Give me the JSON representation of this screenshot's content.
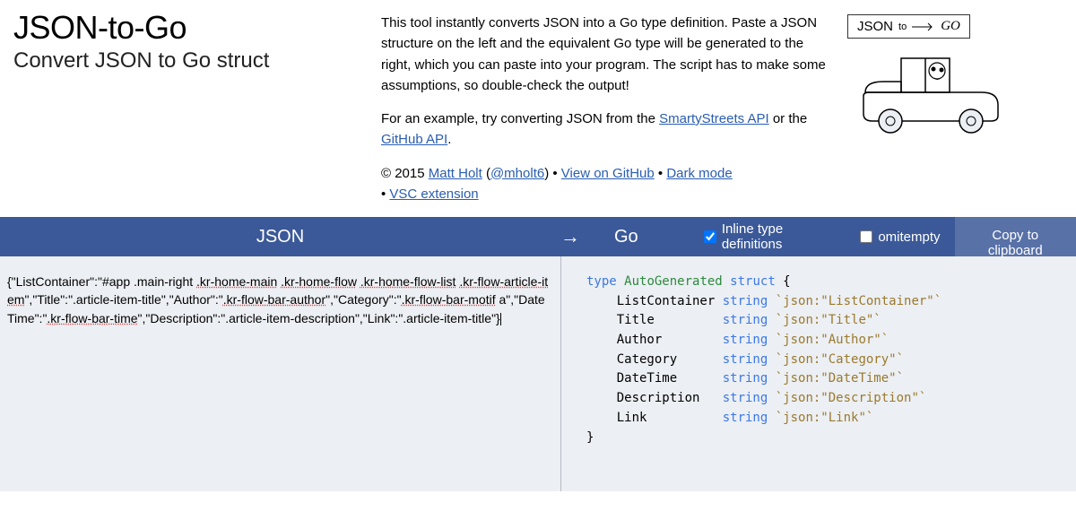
{
  "header": {
    "title": "JSON-to-Go",
    "subtitle": "Convert JSON to Go struct",
    "intro": "This tool instantly converts JSON into a Go type definition. Paste a JSON structure on the left and the equivalent Go type will be generated to the right, which you can paste into your program. The script has to make some assumptions, so double-check the output!",
    "example_prefix": "For an example, try converting JSON from the ",
    "link_smarty": "SmartyStreets API",
    "example_mid": " or the ",
    "link_github": "GitHub API",
    "example_suffix": ".",
    "copyright_prefix": "© 2015 ",
    "link_matt": "Matt Holt",
    "paren_open": " (",
    "link_mholt6": "@mholt6",
    "paren_close": ") • ",
    "link_viewgh": "View on GitHub",
    "sep": " • ",
    "link_dark": "Dark mode",
    "bullet": "• ",
    "link_vsc": "VSC extension",
    "logo_json": "JSON",
    "logo_to": "to",
    "logo_go": "GO"
  },
  "toolbar": {
    "json_label": "JSON",
    "arrow": "→",
    "go_label": "Go",
    "inline_label": "Inline type definitions",
    "inline_checked": true,
    "omitempty_label": "omitempty",
    "omitempty_checked": false,
    "copy_label": "Copy to clipboard"
  },
  "input": {
    "json_text": "{\"ListContainer\":\"#app .main-right .kr-home-main .kr-home-flow .kr-home-flow-list .kr-flow-article-item\",\"Title\":\".article-item-title\",\"Author\":\".kr-flow-bar-author\",\"Category\":\".kr-flow-bar-motif a\",\"DateTime\":\".kr-flow-bar-time\",\"Description\":\".article-item-description\",\"Link\":\".article-item-title\"}"
  },
  "output": {
    "kw_type": "type",
    "type_name": "AutoGenerated",
    "kw_struct": "struct",
    "brace_open": " {",
    "brace_close": "}",
    "fields": [
      {
        "name": "ListContainer",
        "pad": "ListContainer ",
        "type": "string",
        "tag": "`json:\"ListContainer\"`"
      },
      {
        "name": "Title",
        "pad": "Title         ",
        "type": "string",
        "tag": "`json:\"Title\"`"
      },
      {
        "name": "Author",
        "pad": "Author        ",
        "type": "string",
        "tag": "`json:\"Author\"`"
      },
      {
        "name": "Category",
        "pad": "Category      ",
        "type": "string",
        "tag": "`json:\"Category\"`"
      },
      {
        "name": "DateTime",
        "pad": "DateTime      ",
        "type": "string",
        "tag": "`json:\"DateTime\"`"
      },
      {
        "name": "Description",
        "pad": "Description   ",
        "type": "string",
        "tag": "`json:\"Description\"`"
      },
      {
        "name": "Link",
        "pad": "Link          ",
        "type": "string",
        "tag": "`json:\"Link\"`"
      }
    ]
  }
}
